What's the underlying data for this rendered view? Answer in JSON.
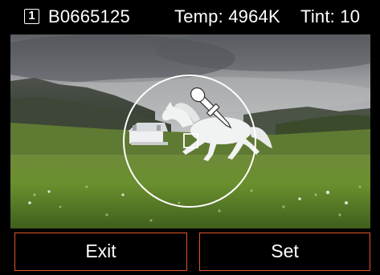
{
  "header": {
    "frame_number": "1",
    "image_id": "B0665125",
    "temperature": "Temp: 4964K",
    "tint": "Tint: 10"
  },
  "viewfinder": {
    "tool_icon": "eyedropper-icon",
    "overlay": "selection-circle"
  },
  "buttons": {
    "exit_label": "Exit",
    "set_label": "Set"
  },
  "colors": {
    "button_border": "#e2552a",
    "background": "#000000",
    "text": "#ffffff"
  }
}
